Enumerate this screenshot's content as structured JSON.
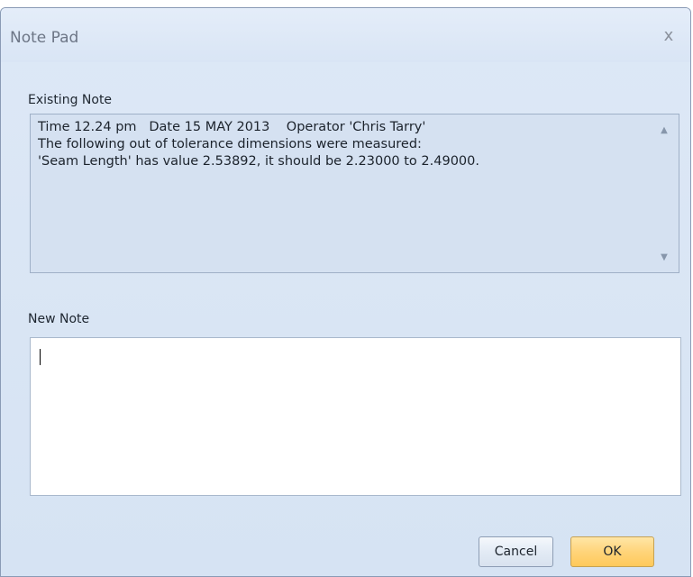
{
  "window": {
    "title": "Note Pad",
    "close_symbol": "x"
  },
  "existing_note": {
    "label": "Existing Note",
    "lines": [
      "Time 12.24 pm   Date 15 MAY 2013    Operator 'Chris Tarry'",
      "The following out of tolerance dimensions were measured:",
      "'Seam Length' has value 2.53892, it should be 2.23000 to 2.49000."
    ],
    "scroll_up_symbol": "▲",
    "scroll_down_symbol": "▼"
  },
  "new_note": {
    "label": "New Note",
    "value": ""
  },
  "buttons": {
    "cancel_label": "Cancel",
    "ok_label": "OK"
  },
  "colors": {
    "ok_accent": "#ffd47a",
    "dialog_background": "#dde8f6"
  }
}
